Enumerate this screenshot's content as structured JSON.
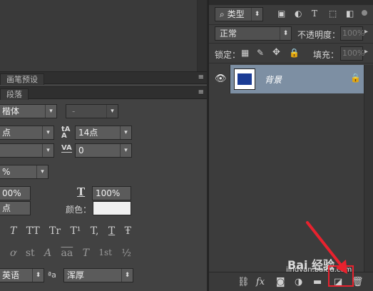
{
  "left": {
    "brush_preset_tab": "画笔预设",
    "paragraph_tab": "段落",
    "font_family": "楷体",
    "font_style": "-",
    "font_size": "点",
    "leading": "14点",
    "kerning": "",
    "tracking": "0",
    "vertical_scale": "%",
    "horizontal_scale_left": "00%",
    "horizontal_scale_right": "100%",
    "baseline": "点",
    "color_label": "颜色：",
    "style_buttons": [
      "T",
      "TT",
      "Tr",
      "T¹",
      "T,",
      "T",
      "Ŧ"
    ],
    "opentype_buttons": [
      "ơ",
      "st",
      "A",
      "aa",
      "T",
      "1st",
      "½"
    ],
    "language": "英语",
    "antialias_prefix": "ªa",
    "antialias": "浑厚"
  },
  "layers": {
    "filter_kind": "类型",
    "blend_mode": "正常",
    "opacity_label": "不透明度：",
    "opacity_value": "100%",
    "lock_label": "锁定：",
    "fill_label": "填充：",
    "fill_value": "100%",
    "layer_name": "背景"
  },
  "watermark": {
    "brand": "Bai 经验",
    "url": "jingyan.baidu.com"
  },
  "colors": {
    "selection": "#7d8fa3",
    "highlight_red": "#e8222e",
    "thumb_blue": "#1b3c95"
  }
}
